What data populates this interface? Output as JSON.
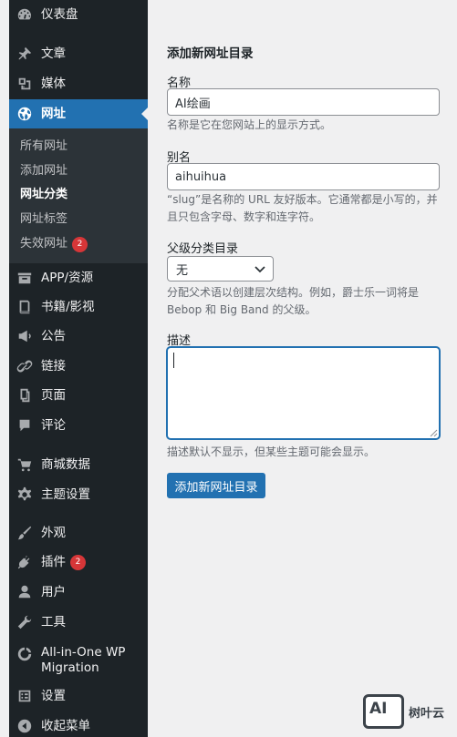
{
  "sidebar": {
    "top": [
      {
        "label": "仪表盘",
        "icon": "dashboard-icon"
      },
      {
        "label": "文章",
        "icon": "pin-icon"
      },
      {
        "label": "媒体",
        "icon": "media-icon"
      },
      {
        "label": "网址",
        "icon": "globe-icon"
      }
    ],
    "submenu": [
      {
        "label": "所有网址"
      },
      {
        "label": "添加网址"
      },
      {
        "label": "网址分类"
      },
      {
        "label": "网址标签"
      },
      {
        "label": "失效网址",
        "badge": "2"
      }
    ],
    "rest": [
      {
        "label": "APP/资源",
        "icon": "archive-icon"
      },
      {
        "label": "书籍/影视",
        "icon": "book-icon"
      },
      {
        "label": "公告",
        "icon": "megaphone-icon"
      },
      {
        "label": "链接",
        "icon": "link-icon"
      },
      {
        "label": "页面",
        "icon": "page-icon"
      },
      {
        "label": "评论",
        "icon": "comment-icon"
      },
      {
        "label": "商城数据",
        "icon": "cart-icon"
      },
      {
        "label": "主题设置",
        "icon": "gear-icon"
      },
      {
        "label": "外观",
        "icon": "brush-icon"
      },
      {
        "label": "插件",
        "icon": "plugin-icon",
        "badge": "2"
      },
      {
        "label": "用户",
        "icon": "user-icon"
      },
      {
        "label": "工具",
        "icon": "wrench-icon"
      },
      {
        "label": "All-in-One WP Migration",
        "icon": "migration-icon"
      },
      {
        "label": "设置",
        "icon": "settings-icon"
      },
      {
        "label": "收起菜单",
        "icon": "collapse-icon"
      }
    ]
  },
  "form": {
    "heading": "添加新网址目录",
    "name_label": "名称",
    "name_value": "AI绘画",
    "name_desc": "名称是它在您网站上的显示方式。",
    "slug_label": "别名",
    "slug_value": "aihuihua",
    "slug_desc": "“slug”是名称的 URL 友好版本。它通常都是小写的，并且只包含字母、数字和连字符。",
    "parent_label": "父级分类目录",
    "parent_value": "无",
    "parent_desc": "分配父术语以创建层次结构。例如，爵士乐一词将是 Bebop 和 Big Band 的父级。",
    "desc_label": "描述",
    "desc_value": "",
    "desc_desc": "描述默认不显示，但某些主题可能会显示。",
    "submit_label": "添加新网址目录"
  },
  "watermark": {
    "logo_text": "AI",
    "text": "树叶云"
  },
  "colors": {
    "sidebar_bg": "#1d2327",
    "accent": "#2271b1",
    "badge": "#d63638"
  }
}
